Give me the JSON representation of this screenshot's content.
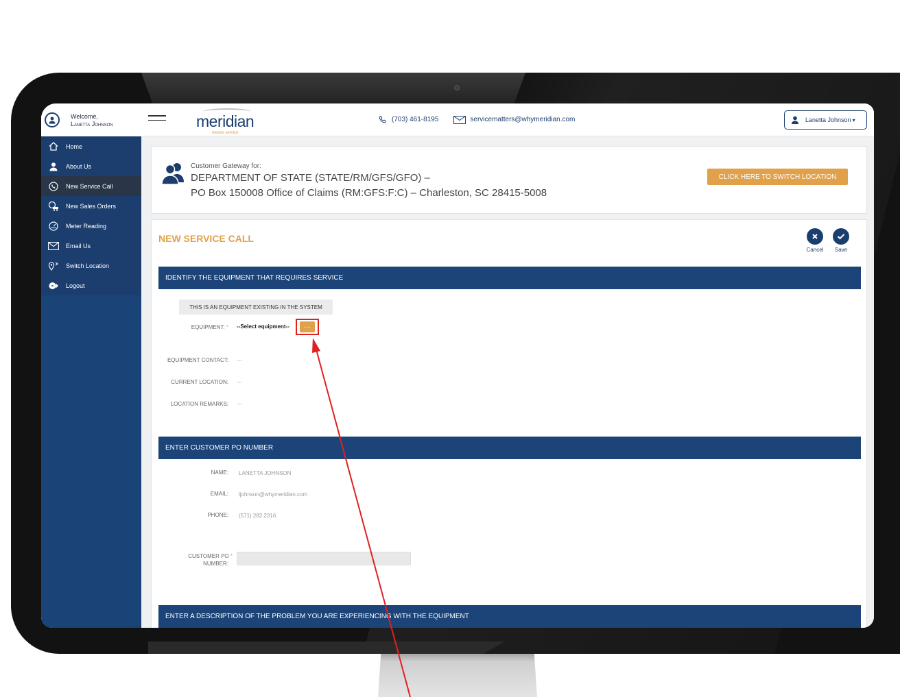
{
  "header": {
    "welcome": "Welcome,",
    "user_name": "Lanetta Johnson",
    "logo_word": "meridian",
    "logo_tag": "means service",
    "phone": "(703) 461-8195",
    "email": "servicematters@whymeridian.com",
    "user_menu_label": "Lanetta Johnson"
  },
  "sidebar": {
    "items": [
      {
        "label": "Home",
        "icon": "home-icon"
      },
      {
        "label": "About Us",
        "icon": "person-icon"
      },
      {
        "label": "New Service Call",
        "icon": "phone-icon"
      },
      {
        "label": "New Sales Orders",
        "icon": "truck-icon"
      },
      {
        "label": "Meter Reading",
        "icon": "gauge-icon"
      },
      {
        "label": "Email Us",
        "icon": "envelope-icon"
      },
      {
        "label": "Switch Location",
        "icon": "location-icon"
      },
      {
        "label": "Logout",
        "icon": "logout-icon"
      }
    ],
    "active_index": 2
  },
  "gateway": {
    "label": "Customer Gateway for:",
    "line1": "DEPARTMENT OF STATE (STATE/RM/GFS/GFO) –",
    "line2": "PO Box 150008 Office of Claims (RM:GFS:F:C) – Charleston, SC 28415-5008",
    "switch_button": "CLICK HERE TO SWITCH LOCATION"
  },
  "panel": {
    "title": "NEW SERVICE CALL",
    "cancel_label": "Cancel",
    "save_label": "Save",
    "sections": {
      "equipment": "IDENTIFY THE EQUIPMENT THAT REQUIRES SERVICE",
      "po": "ENTER CUSTOMER PO NUMBER",
      "description": "ENTER A DESCRIPTION OF THE PROBLEM YOU ARE EXPERIENCING WITH THE EQUIPMENT"
    },
    "equipment_tab": "THIS IS AN EQUIPMENT EXISTING IN THE SYSTEM",
    "equipment_label": "EQUIPMENT:",
    "equipment_value": "--Select equipment--",
    "equipment_button": "···",
    "contact_label": "EQUIPMENT CONTACT:",
    "contact_value": "---",
    "location_label": "CURRENT LOCATION:",
    "location_value": "---",
    "remarks_label": "LOCATION REMARKS:",
    "remarks_value": "---",
    "name_label": "NAME:",
    "name_value": "LANETTA JOHNSON",
    "email_label": "EMAIL:",
    "email_value": "ljohnson@whymeridian.com",
    "phone_label": "PHONE:",
    "phone_value": "(571) 282.2316",
    "po_label_1": "CUSTOMER PO",
    "po_label_2": "NUMBER:",
    "po_value": ""
  },
  "colors": {
    "brand_navy": "#1c3e6e",
    "accent_orange": "#e0a14a",
    "annotation_red": "#e02020"
  }
}
